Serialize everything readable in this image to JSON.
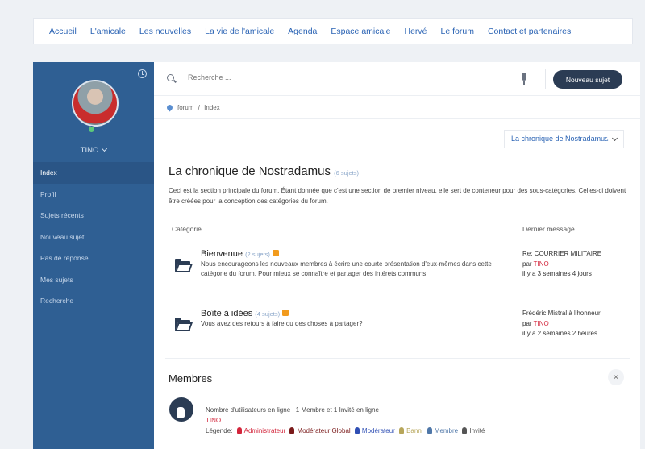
{
  "topnav": [
    "Accueil",
    "L'amicale",
    "Les nouvelles",
    "La vie de l'amicale",
    "Agenda",
    "Espace amicale",
    "Hervé",
    "Le forum",
    "Contact et partenaires"
  ],
  "sidebar": {
    "username": "TINO",
    "items": [
      "Index",
      "Profil",
      "Sujets récents",
      "Nouveau sujet",
      "Pas de réponse",
      "Mes sujets",
      "Recherche"
    ]
  },
  "search": {
    "placeholder": "Recherche ..."
  },
  "toolbar": {
    "new_topic": "Nouveau sujet"
  },
  "breadcrumb": {
    "forum": "forum",
    "sep": "/",
    "current": "Index"
  },
  "forum_select": {
    "value": "La chronique de Nostradamus"
  },
  "page": {
    "title": "La chronique de Nostradamus",
    "count": "(6 sujets)",
    "description": "Ceci est la section principale du forum. Étant donnée que c'est une section de premier niveau, elle sert de conteneur pour des sous-catégories. Celles-ci doivent être créées pour la conception des catégories du forum."
  },
  "columns": {
    "category": "Catégorie",
    "last_message": "Dernier message"
  },
  "forums": [
    {
      "name": "Bienvenue",
      "count": "(2 sujets)",
      "description": "Nous encourageons les nouveaux membres à écrire une courte présentation d'eux-mêmes dans cette catégorie du forum. Pour mieux se connaître et partager des intérets communs.",
      "last_title": "Re: COURRIER MILITAIRE",
      "by": "par",
      "author": "TINO",
      "when": "il y a 3 semaines 4 jours"
    },
    {
      "name": "Boîte à idées",
      "count": "(4 sujets)",
      "description": "Vous avez des retours à faire ou des choses à partager?",
      "last_title": "Frédéric Mistral à l'honneur",
      "by": "par",
      "author": "TINO",
      "when": "il y a 2 semaines 2 heures"
    }
  ],
  "members": {
    "title": "Membres",
    "online_text": "Nombre d'utilisateurs en ligne : 1 Membre et 1 Invité en ligne",
    "online_user": "TINO",
    "legend_label": "Légende:",
    "roles": [
      {
        "name": "Administrateur",
        "color": "#d3253b"
      },
      {
        "name": "Modérateur Global",
        "color": "#7a1a1a"
      },
      {
        "name": "Modérateur",
        "color": "#2f4fb4"
      },
      {
        "name": "Banni",
        "color": "#b7a65a"
      },
      {
        "name": "Membre",
        "color": "#4f77a8"
      },
      {
        "name": "Invité",
        "color": "#555555"
      }
    ]
  }
}
